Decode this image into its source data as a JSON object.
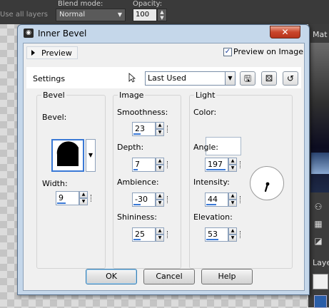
{
  "app_toolbar": {
    "use_all_layers": "Use all layers",
    "blend_mode_label": "Blend mode:",
    "blend_mode_value": "Normal",
    "opacity_label": "Opacity:",
    "opacity_value": "100"
  },
  "right_panel": {
    "materials_label": "Mat",
    "layers_label": "Laye"
  },
  "dialog": {
    "title": "Inner Bevel",
    "close_glyph": "✕",
    "preview_label": "Preview",
    "preview_on_image_label": "Preview on Image",
    "preview_on_image_checked": true,
    "settings_label": "Settings",
    "preset_value": "Last Used",
    "bevel_group": {
      "title": "Bevel",
      "bevel_label": "Bevel:",
      "width_label": "Width:",
      "width_value": "9"
    },
    "image_group": {
      "title": "Image",
      "smoothness_label": "Smoothness:",
      "smoothness_value": "23",
      "depth_label": "Depth:",
      "depth_value": "7",
      "ambience_label": "Ambience:",
      "ambience_value": "-30",
      "shininess_label": "Shininess:",
      "shininess_value": "25"
    },
    "light_group": {
      "title": "Light",
      "color_label": "Color:",
      "color_value": "#ffffff",
      "angle_label": "Angle:",
      "angle_value": "197",
      "intensity_label": "Intensity:",
      "intensity_value": "44",
      "elevation_label": "Elevation:",
      "elevation_value": "53"
    },
    "ok_label": "OK",
    "cancel_label": "Cancel",
    "help_label": "Help"
  },
  "colors": {
    "accent": "#3a79d6",
    "close_button": "#c9452b",
    "title_background": "#c5d7ea"
  }
}
